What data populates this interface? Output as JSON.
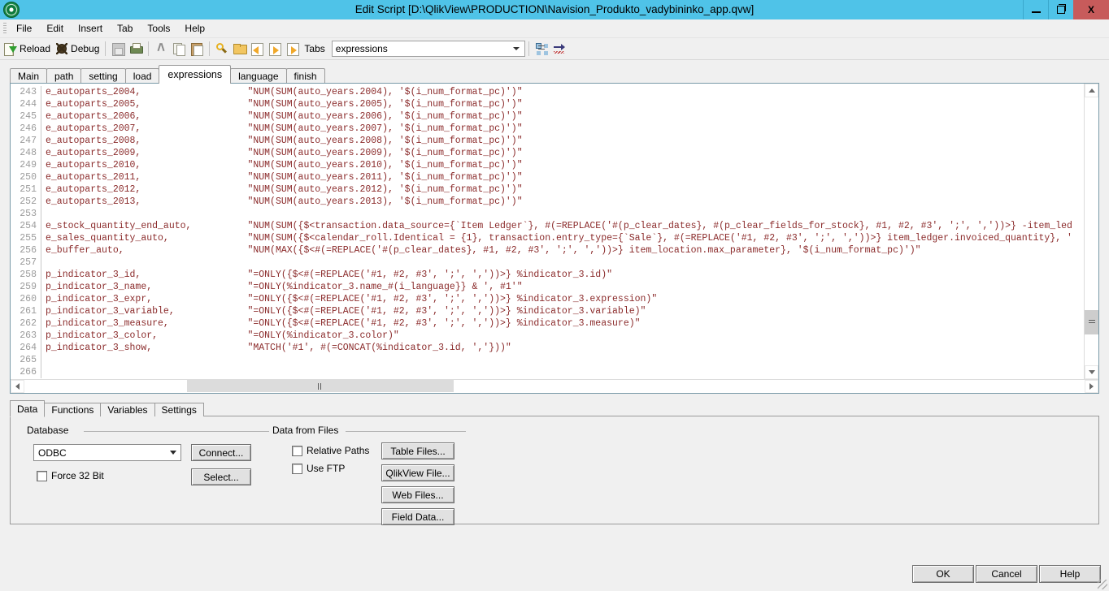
{
  "window": {
    "title": "Edit Script [D:\\QlikView\\PRODUCTION\\Navision_Produkto_vadybininko_app.qvw]",
    "minimize_label": "Minimize",
    "maximize_label": "Maximize",
    "close_label": "X"
  },
  "menubar": [
    {
      "label": "File"
    },
    {
      "label": "Edit"
    },
    {
      "label": "Insert"
    },
    {
      "label": "Tab"
    },
    {
      "label": "Tools"
    },
    {
      "label": "Help"
    }
  ],
  "toolbar": {
    "reload_label": "Reload",
    "debug_label": "Debug",
    "tabs_label": "Tabs",
    "tabs_selected": "expressions",
    "icons": [
      "reload-icon",
      "debug-icon",
      "save-icon",
      "print-icon",
      "cut-icon",
      "copy-icon",
      "paste-icon",
      "find-icon",
      "folder-icon",
      "previous-tab-icon",
      "next-tab-icon",
      "tabs-icon",
      "tab-organize-icon",
      "auto-format-icon"
    ]
  },
  "script_tabs": [
    {
      "label": "Main",
      "active": false
    },
    {
      "label": "path",
      "active": false
    },
    {
      "label": "setting",
      "active": false
    },
    {
      "label": "load",
      "active": false
    },
    {
      "label": "expressions",
      "active": true
    },
    {
      "label": "language",
      "active": false
    },
    {
      "label": "finish",
      "active": false
    }
  ],
  "editor": {
    "lines": [
      {
        "num": "243",
        "text": "e_autoparts_2004,                   \"NUM(SUM(auto_years.2004), '$(i_num_format_pc)')\""
      },
      {
        "num": "244",
        "text": "e_autoparts_2005,                   \"NUM(SUM(auto_years.2005), '$(i_num_format_pc)')\""
      },
      {
        "num": "245",
        "text": "e_autoparts_2006,                   \"NUM(SUM(auto_years.2006), '$(i_num_format_pc)')\""
      },
      {
        "num": "246",
        "text": "e_autoparts_2007,                   \"NUM(SUM(auto_years.2007), '$(i_num_format_pc)')\""
      },
      {
        "num": "247",
        "text": "e_autoparts_2008,                   \"NUM(SUM(auto_years.2008), '$(i_num_format_pc)')\""
      },
      {
        "num": "248",
        "text": "e_autoparts_2009,                   \"NUM(SUM(auto_years.2009), '$(i_num_format_pc)')\""
      },
      {
        "num": "249",
        "text": "e_autoparts_2010,                   \"NUM(SUM(auto_years.2010), '$(i_num_format_pc)')\""
      },
      {
        "num": "250",
        "text": "e_autoparts_2011,                   \"NUM(SUM(auto_years.2011), '$(i_num_format_pc)')\""
      },
      {
        "num": "251",
        "text": "e_autoparts_2012,                   \"NUM(SUM(auto_years.2012), '$(i_num_format_pc)')\""
      },
      {
        "num": "252",
        "text": "e_autoparts_2013,                   \"NUM(SUM(auto_years.2013), '$(i_num_format_pc)')\""
      },
      {
        "num": "253",
        "text": ""
      },
      {
        "num": "254",
        "text": "e_stock_quantity_end_auto,          \"NUM(SUM({$<transaction.data_source={`Item Ledger`}, #(=REPLACE('#(p_clear_dates}, #(p_clear_fields_for_stock}, #1, #2, #3', ';', ','))>} -item_led"
      },
      {
        "num": "255",
        "text": "e_sales_quantity_auto,              \"NUM(SUM({$<calendar_roll.Identical = {1}, transaction.entry_type={`Sale`}, #(=REPLACE('#1, #2, #3', ';', ','))>} item_ledger.invoiced_quantity}, '"
      },
      {
        "num": "256",
        "text": "e_buffer_auto,                      \"NUM(MAX({$<#(=REPLACE('#(p_clear_dates}, #1, #2, #3', ';', ','))>} item_location.max_parameter}, '$(i_num_format_pc)')\""
      },
      {
        "num": "257",
        "text": ""
      },
      {
        "num": "258",
        "text": "p_indicator_3_id,                   \"=ONLY({$<#(=REPLACE('#1, #2, #3', ';', ','))>} %indicator_3.id)\""
      },
      {
        "num": "259",
        "text": "p_indicator_3_name,                 \"=ONLY(%indicator_3.name_#(i_language}} & ', #1'\""
      },
      {
        "num": "260",
        "text": "p_indicator_3_expr,                 \"=ONLY({$<#(=REPLACE('#1, #2, #3', ';', ','))>} %indicator_3.expression)\""
      },
      {
        "num": "261",
        "text": "p_indicator_3_variable,             \"=ONLY({$<#(=REPLACE('#1, #2, #3', ';', ','))>} %indicator_3.variable)\""
      },
      {
        "num": "262",
        "text": "p_indicator_3_measure,              \"=ONLY({$<#(=REPLACE('#1, #2, #3', ';', ','))>} %indicator_3.measure)\""
      },
      {
        "num": "263",
        "text": "p_indicator_3_color,                \"=ONLY(%indicator_3.color)\""
      },
      {
        "num": "264",
        "text": "p_indicator_3_show,                 \"MATCH('#1', #(=CONCAT(%indicator_3.id, ','}))\""
      },
      {
        "num": "265",
        "text": ""
      },
      {
        "num": "266",
        "text": ""
      }
    ],
    "text_color": "#8b2b2b",
    "gutter_color": "#9b9b9b"
  },
  "bottom_tabs": [
    {
      "label": "Data",
      "active": true
    },
    {
      "label": "Functions",
      "active": false
    },
    {
      "label": "Variables",
      "active": false
    },
    {
      "label": "Settings",
      "active": false
    }
  ],
  "database_group": {
    "title": "Database",
    "connector_value": "ODBC",
    "connect_label": "Connect...",
    "select_label": "Select...",
    "force32_label": "Force 32 Bit",
    "force32_checked": false
  },
  "data_from_files_group": {
    "title": "Data from Files",
    "relative_paths_label": "Relative Paths",
    "relative_paths_checked": false,
    "use_ftp_label": "Use FTP",
    "use_ftp_checked": false,
    "buttons": [
      {
        "label": "Table Files..."
      },
      {
        "label": "QlikView File..."
      },
      {
        "label": "Web Files..."
      },
      {
        "label": "Field Data..."
      }
    ]
  },
  "footer": {
    "ok_label": "OK",
    "cancel_label": "Cancel",
    "help_label": "Help"
  },
  "colors": {
    "titlebar": "#4fc3e8",
    "close_button": "#c75b5b",
    "dialog_face": "#f0f0f0",
    "code_text": "#8b2b2b"
  }
}
